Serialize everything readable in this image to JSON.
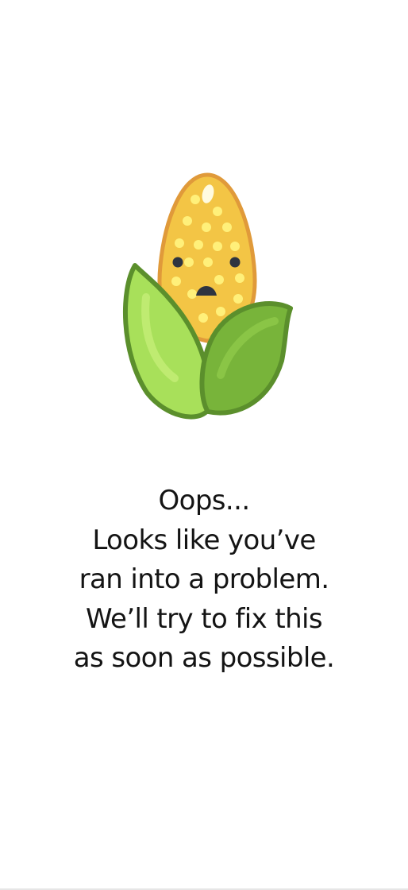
{
  "error_screen": {
    "illustration_icon": "sad-corn-icon",
    "message_lines": [
      "Oops...",
      "Looks like you’ve",
      "ran into a problem.",
      "We’ll try to fix this",
      "as soon as possible."
    ]
  },
  "colors": {
    "background": "#ffffff",
    "text": "#141414",
    "corn_outline": "#e09a3a",
    "corn_fill": "#f3c545",
    "kernel": "#fff07a",
    "leaf_light": "#a8e05a",
    "leaf_dark": "#78b43a",
    "leaf_outline": "#5b8f2c",
    "face": "#2e3440"
  }
}
